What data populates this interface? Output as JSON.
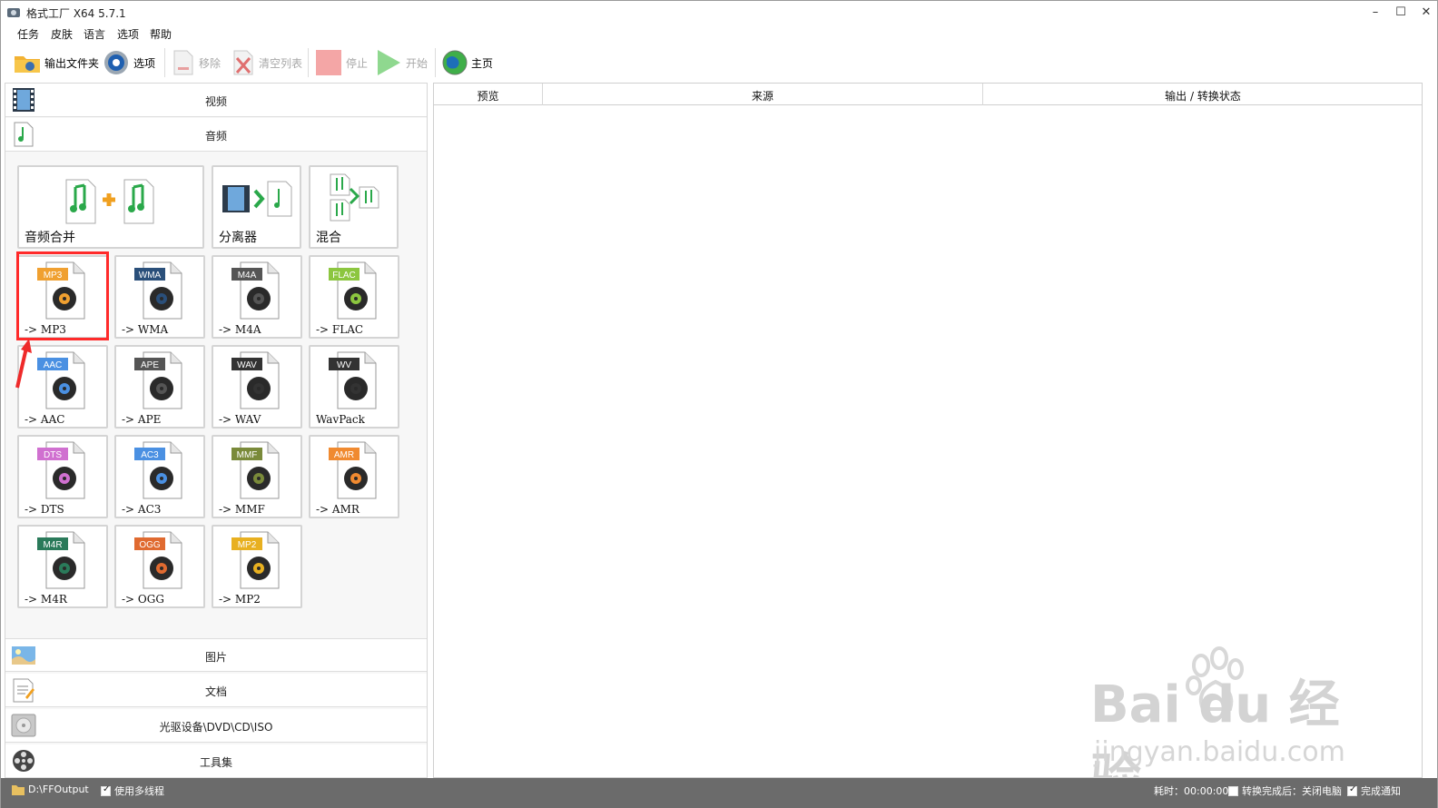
{
  "window": {
    "title": "格式工厂 X64 5.7.1",
    "controls": {
      "minimize": "–",
      "maximize": "☐",
      "close": "✕"
    }
  },
  "menu": [
    "任务",
    "皮肤",
    "语言",
    "选项",
    "帮助"
  ],
  "toolbar": {
    "output_folder": "输出文件夹",
    "options": "选项",
    "remove": "移除",
    "clear_list": "清空列表",
    "stop": "停止",
    "start": "开始",
    "home": "主页"
  },
  "categories": {
    "video": "视频",
    "audio": "音频",
    "picture": "图片",
    "document": "文档",
    "disc": "光驱设备\\DVD\\CD\\ISO",
    "tools": "工具集"
  },
  "audio_tiles": {
    "merge": "音频合并",
    "splitter": "分离器",
    "mix": "混合",
    "formats": [
      {
        "badge": "MP3",
        "label": "-> MP3",
        "color": "#f0a030"
      },
      {
        "badge": "WMA",
        "label": "-> WMA",
        "color": "#2a4f7a"
      },
      {
        "badge": "M4A",
        "label": "-> M4A",
        "color": "#555555"
      },
      {
        "badge": "FLAC",
        "label": "-> FLAC",
        "color": "#8cc63f"
      },
      {
        "badge": "AAC",
        "label": "-> AAC",
        "color": "#4a90e2"
      },
      {
        "badge": "APE",
        "label": "-> APE",
        "color": "#555555"
      },
      {
        "badge": "WAV",
        "label": "-> WAV",
        "color": "#333333"
      },
      {
        "badge": "WV",
        "label": "WavPack",
        "color": "#333333"
      },
      {
        "badge": "DTS",
        "label": "-> DTS",
        "color": "#d070d0"
      },
      {
        "badge": "AC3",
        "label": "-> AC3",
        "color": "#4a90e2"
      },
      {
        "badge": "MMF",
        "label": "-> MMF",
        "color": "#7a8a3a"
      },
      {
        "badge": "AMR",
        "label": "-> AMR",
        "color": "#f08a30"
      },
      {
        "badge": "M4R",
        "label": "-> M4R",
        "color": "#2a7a5a"
      },
      {
        "badge": "OGG",
        "label": "-> OGG",
        "color": "#e06a30"
      },
      {
        "badge": "MP2",
        "label": "-> MP2",
        "color": "#e8b020"
      }
    ]
  },
  "table": {
    "headers": [
      "预览",
      "来源",
      "输出 / 转换状态"
    ]
  },
  "watermark": {
    "line1": "Bai du 经验",
    "line2": "jingyan.baidu.com"
  },
  "statusbar": {
    "output_path": "D:\\FFOutput",
    "multithread": "使用多线程",
    "elapsed": "耗时：00:00:00",
    "after_convert": "转换完成后：关闭电脑",
    "notify": "完成通知"
  }
}
